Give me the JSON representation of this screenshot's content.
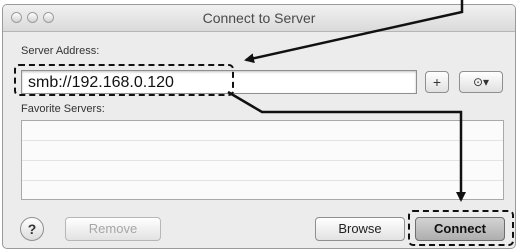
{
  "window": {
    "title": "Connect to Server"
  },
  "server_address": {
    "label": "Server Address:",
    "value": "smb://192.168.0.120",
    "add_button_label": "+",
    "recent_button_label": "⊙▾"
  },
  "favorites": {
    "label": "Favorite Servers:",
    "items": []
  },
  "footer": {
    "help_label": "?",
    "remove_label": "Remove",
    "browse_label": "Browse",
    "connect_label": "Connect"
  }
}
